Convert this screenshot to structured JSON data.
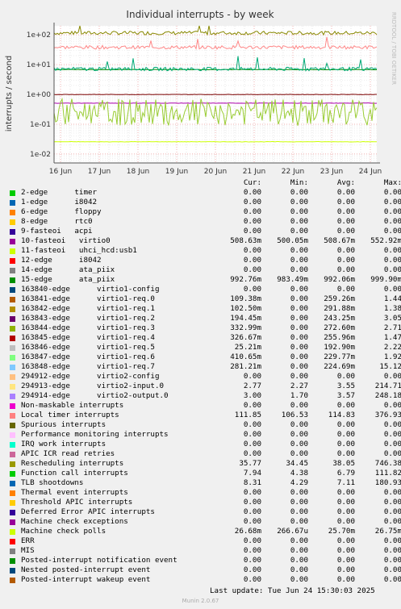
{
  "chart_data": {
    "type": "line",
    "title": "Individual interrupts - by week",
    "ylabel": "interrupts / second",
    "yscale": "log",
    "ylim": [
      0.005,
      200
    ],
    "y_ticks": [
      {
        "v": 100,
        "label": "1e+02"
      },
      {
        "v": 10,
        "label": "1e+01"
      },
      {
        "v": 1,
        "label": "1e+00"
      },
      {
        "v": 0.1,
        "label": "1e-01"
      },
      {
        "v": 0.01,
        "label": "1e-02"
      }
    ],
    "x_ticks": [
      "16 Jun",
      "17 Jun",
      "18 Jun",
      "19 Jun",
      "20 Jun",
      "21 Jun",
      "22 Jun",
      "23 Jun",
      "24 Jun"
    ],
    "grid": true,
    "side_label": "RRDTOOL / TOBI OETIKER",
    "series_levels": [
      {
        "name": "Local timer interrupts",
        "color": "#888800",
        "level": 114.83,
        "spiky": true
      },
      {
        "name": "Rescheduling interrupts",
        "color": "#FF8888",
        "level": 38.05,
        "spiky": true
      },
      {
        "name": "Function call interrupts",
        "color": "#008800",
        "level": 6.79,
        "spiky": false
      },
      {
        "name": "TLB shootdowns",
        "color": "#00AA77",
        "level": 7.11,
        "spiky": true
      },
      {
        "name": "10-fasteoi virtio0",
        "color": "#AA00AA",
        "level": 0.509,
        "spiky": false
      },
      {
        "name": "15-edge ata_piix",
        "color": "#7A0000",
        "level": 0.992,
        "spiky": false
      },
      {
        "name": "virtio1 queues",
        "color": "#99CC33",
        "level": 0.25,
        "spiky": true
      },
      {
        "name": "Machine check polls",
        "color": "#CCFF00",
        "level": 0.0257,
        "spiky": false
      }
    ]
  },
  "legend": {
    "headers": [
      "Cur:",
      "Min:",
      "Avg:",
      "Max:"
    ],
    "rows": [
      {
        "color": "#00CC00",
        "label": "2-edge      timer",
        "cur": "0.00",
        "min": "0.00",
        "avg": "0.00",
        "max": "0.00"
      },
      {
        "color": "#0066B3",
        "label": "1-edge      i8042",
        "cur": "0.00",
        "min": "0.00",
        "avg": "0.00",
        "max": "0.00"
      },
      {
        "color": "#FF8000",
        "label": "6-edge      floppy",
        "cur": "0.00",
        "min": "0.00",
        "avg": "0.00",
        "max": "0.00"
      },
      {
        "color": "#FFCC00",
        "label": "8-edge      rtc0",
        "cur": "0.00",
        "min": "0.00",
        "avg": "0.00",
        "max": "0.00"
      },
      {
        "color": "#330099",
        "label": "9-fasteoi   acpi",
        "cur": "0.00",
        "min": "0.00",
        "avg": "0.00",
        "max": "0.00"
      },
      {
        "color": "#990099",
        "label": "10-fasteoi   virtio0",
        "cur": "508.63m",
        "min": "500.05m",
        "avg": "508.67m",
        "max": "552.92m"
      },
      {
        "color": "#CCFF00",
        "label": "11-fasteoi   uhci_hcd:usb1",
        "cur": "0.00",
        "min": "0.00",
        "avg": "0.00",
        "max": "0.00"
      },
      {
        "color": "#FF0000",
        "label": "12-edge      i8042",
        "cur": "0.00",
        "min": "0.00",
        "avg": "0.00",
        "max": "0.00"
      },
      {
        "color": "#808080",
        "label": "14-edge      ata_piix",
        "cur": "0.00",
        "min": "0.00",
        "avg": "0.00",
        "max": "0.00"
      },
      {
        "color": "#008F00",
        "label": "15-edge      ata_piix",
        "cur": "992.76m",
        "min": "983.49m",
        "avg": "992.06m",
        "max": "999.90m"
      },
      {
        "color": "#00487D",
        "label": "163840-edge      virtio1-config",
        "cur": "0.00",
        "min": "0.00",
        "avg": "0.00",
        "max": "0.00"
      },
      {
        "color": "#B35A00",
        "label": "163841-edge      virtio1-req.0",
        "cur": "109.38m",
        "min": "0.00",
        "avg": "259.26m",
        "max": "1.44"
      },
      {
        "color": "#B38F00",
        "label": "163842-edge      virtio1-req.1",
        "cur": "102.50m",
        "min": "0.00",
        "avg": "291.88m",
        "max": "1.38"
      },
      {
        "color": "#6B006B",
        "label": "163843-edge      virtio1-req.2",
        "cur": "194.45m",
        "min": "0.00",
        "avg": "243.25m",
        "max": "3.05"
      },
      {
        "color": "#8FB300",
        "label": "163844-edge      virtio1-req.3",
        "cur": "332.99m",
        "min": "0.00",
        "avg": "272.60m",
        "max": "2.71"
      },
      {
        "color": "#B30000",
        "label": "163845-edge      virtio1-req.4",
        "cur": "326.67m",
        "min": "0.00",
        "avg": "255.96m",
        "max": "1.47"
      },
      {
        "color": "#BEBEBE",
        "label": "163846-edge      virtio1-req.5",
        "cur": "25.21m",
        "min": "0.00",
        "avg": "192.90m",
        "max": "2.22"
      },
      {
        "color": "#80FF80",
        "label": "163847-edge      virtio1-req.6",
        "cur": "410.65m",
        "min": "0.00",
        "avg": "229.77m",
        "max": "1.92"
      },
      {
        "color": "#80C9FF",
        "label": "163848-edge      virtio1-req.7",
        "cur": "281.21m",
        "min": "0.00",
        "avg": "224.69m",
        "max": "15.12"
      },
      {
        "color": "#FFC080",
        "label": "294912-edge      virtio2-config",
        "cur": "0.00",
        "min": "0.00",
        "avg": "0.00",
        "max": "0.00"
      },
      {
        "color": "#FFE680",
        "label": "294913-edge      virtio2-input.0",
        "cur": "2.77",
        "min": "2.27",
        "avg": "3.55",
        "max": "214.71"
      },
      {
        "color": "#AA80FF",
        "label": "294914-edge      virtio2-output.0",
        "cur": "3.00",
        "min": "1.70",
        "avg": "3.57",
        "max": "248.18"
      },
      {
        "color": "#EE00CC",
        "label": "Non-maskable interrupts",
        "cur": "0.00",
        "min": "0.00",
        "avg": "0.00",
        "max": "0.00"
      },
      {
        "color": "#FF8080",
        "label": "Local timer interrupts",
        "cur": "111.85",
        "min": "106.53",
        "avg": "114.83",
        "max": "376.93"
      },
      {
        "color": "#666600",
        "label": "Spurious interrupts",
        "cur": "0.00",
        "min": "0.00",
        "avg": "0.00",
        "max": "0.00"
      },
      {
        "color": "#FFBFFF",
        "label": "Performance monitoring interrupts",
        "cur": "0.00",
        "min": "0.00",
        "avg": "0.00",
        "max": "0.00"
      },
      {
        "color": "#00FFCC",
        "label": "IRQ work interrupts",
        "cur": "0.00",
        "min": "0.00",
        "avg": "0.00",
        "max": "0.00"
      },
      {
        "color": "#CC6699",
        "label": "APIC ICR read retries",
        "cur": "0.00",
        "min": "0.00",
        "avg": "0.00",
        "max": "0.00"
      },
      {
        "color": "#999900",
        "label": "Rescheduling interrupts",
        "cur": "35.77",
        "min": "34.45",
        "avg": "38.05",
        "max": "746.38"
      },
      {
        "color": "#00CC00",
        "label": "Function call interrupts",
        "cur": "7.94",
        "min": "4.38",
        "avg": "6.79",
        "max": "111.82"
      },
      {
        "color": "#0066B3",
        "label": "TLB shootdowns",
        "cur": "8.31",
        "min": "4.29",
        "avg": "7.11",
        "max": "180.93"
      },
      {
        "color": "#FF8000",
        "label": "Thermal event interrupts",
        "cur": "0.00",
        "min": "0.00",
        "avg": "0.00",
        "max": "0.00"
      },
      {
        "color": "#FFCC00",
        "label": "Threshold APIC interrupts",
        "cur": "0.00",
        "min": "0.00",
        "avg": "0.00",
        "max": "0.00"
      },
      {
        "color": "#330099",
        "label": "Deferred Error APIC interrupts",
        "cur": "0.00",
        "min": "0.00",
        "avg": "0.00",
        "max": "0.00"
      },
      {
        "color": "#990099",
        "label": "Machine check exceptions",
        "cur": "0.00",
        "min": "0.00",
        "avg": "0.00",
        "max": "0.00"
      },
      {
        "color": "#CCFF00",
        "label": "Machine check polls",
        "cur": "26.68m",
        "min": "266.67u",
        "avg": "25.70m",
        "max": "26.75m"
      },
      {
        "color": "#FF0000",
        "label": "ERR",
        "cur": "0.00",
        "min": "0.00",
        "avg": "0.00",
        "max": "0.00"
      },
      {
        "color": "#808080",
        "label": "MIS",
        "cur": "0.00",
        "min": "0.00",
        "avg": "0.00",
        "max": "0.00"
      },
      {
        "color": "#008F00",
        "label": "Posted-interrupt notification event",
        "cur": "0.00",
        "min": "0.00",
        "avg": "0.00",
        "max": "0.00"
      },
      {
        "color": "#00487D",
        "label": "Nested posted-interrupt event",
        "cur": "0.00",
        "min": "0.00",
        "avg": "0.00",
        "max": "0.00"
      },
      {
        "color": "#B35A00",
        "label": "Posted-interrupt wakeup event",
        "cur": "0.00",
        "min": "0.00",
        "avg": "0.00",
        "max": "0.00"
      }
    ]
  },
  "last_update": "Last update: Tue Jun 24 15:30:03 2025",
  "footer": "Munin 2.0.67"
}
